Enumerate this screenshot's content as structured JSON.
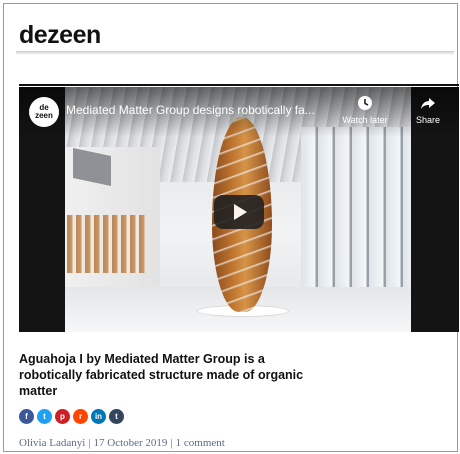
{
  "site": {
    "logo": "dezeen"
  },
  "video": {
    "channel_avatar_text": "de\nzeen",
    "title": "Mediated Matter Group designs robotically fa...",
    "watch_later_label": "Watch later",
    "share_label": "Share",
    "icons": {
      "watch_later": "clock-icon",
      "share": "share-arrow-icon",
      "play": "play-icon"
    }
  },
  "article": {
    "headline": "Aguahoja I by Mediated Matter Group is a robotically fabricated structure made of organic matter"
  },
  "social": [
    {
      "name": "facebook",
      "glyph": "f",
      "color": "#3b5998"
    },
    {
      "name": "twitter",
      "glyph": "t",
      "color": "#1da1f2"
    },
    {
      "name": "pinterest",
      "glyph": "p",
      "color": "#cb2027"
    },
    {
      "name": "reddit",
      "glyph": "r",
      "color": "#ff4500"
    },
    {
      "name": "linkedin",
      "glyph": "in",
      "color": "#0077b5"
    },
    {
      "name": "tumblr",
      "glyph": "t",
      "color": "#35465c"
    }
  ],
  "byline": {
    "author": "Olivia Ladanyi",
    "date": "17 October 2019",
    "comments": "1 comment",
    "separator": "|"
  }
}
